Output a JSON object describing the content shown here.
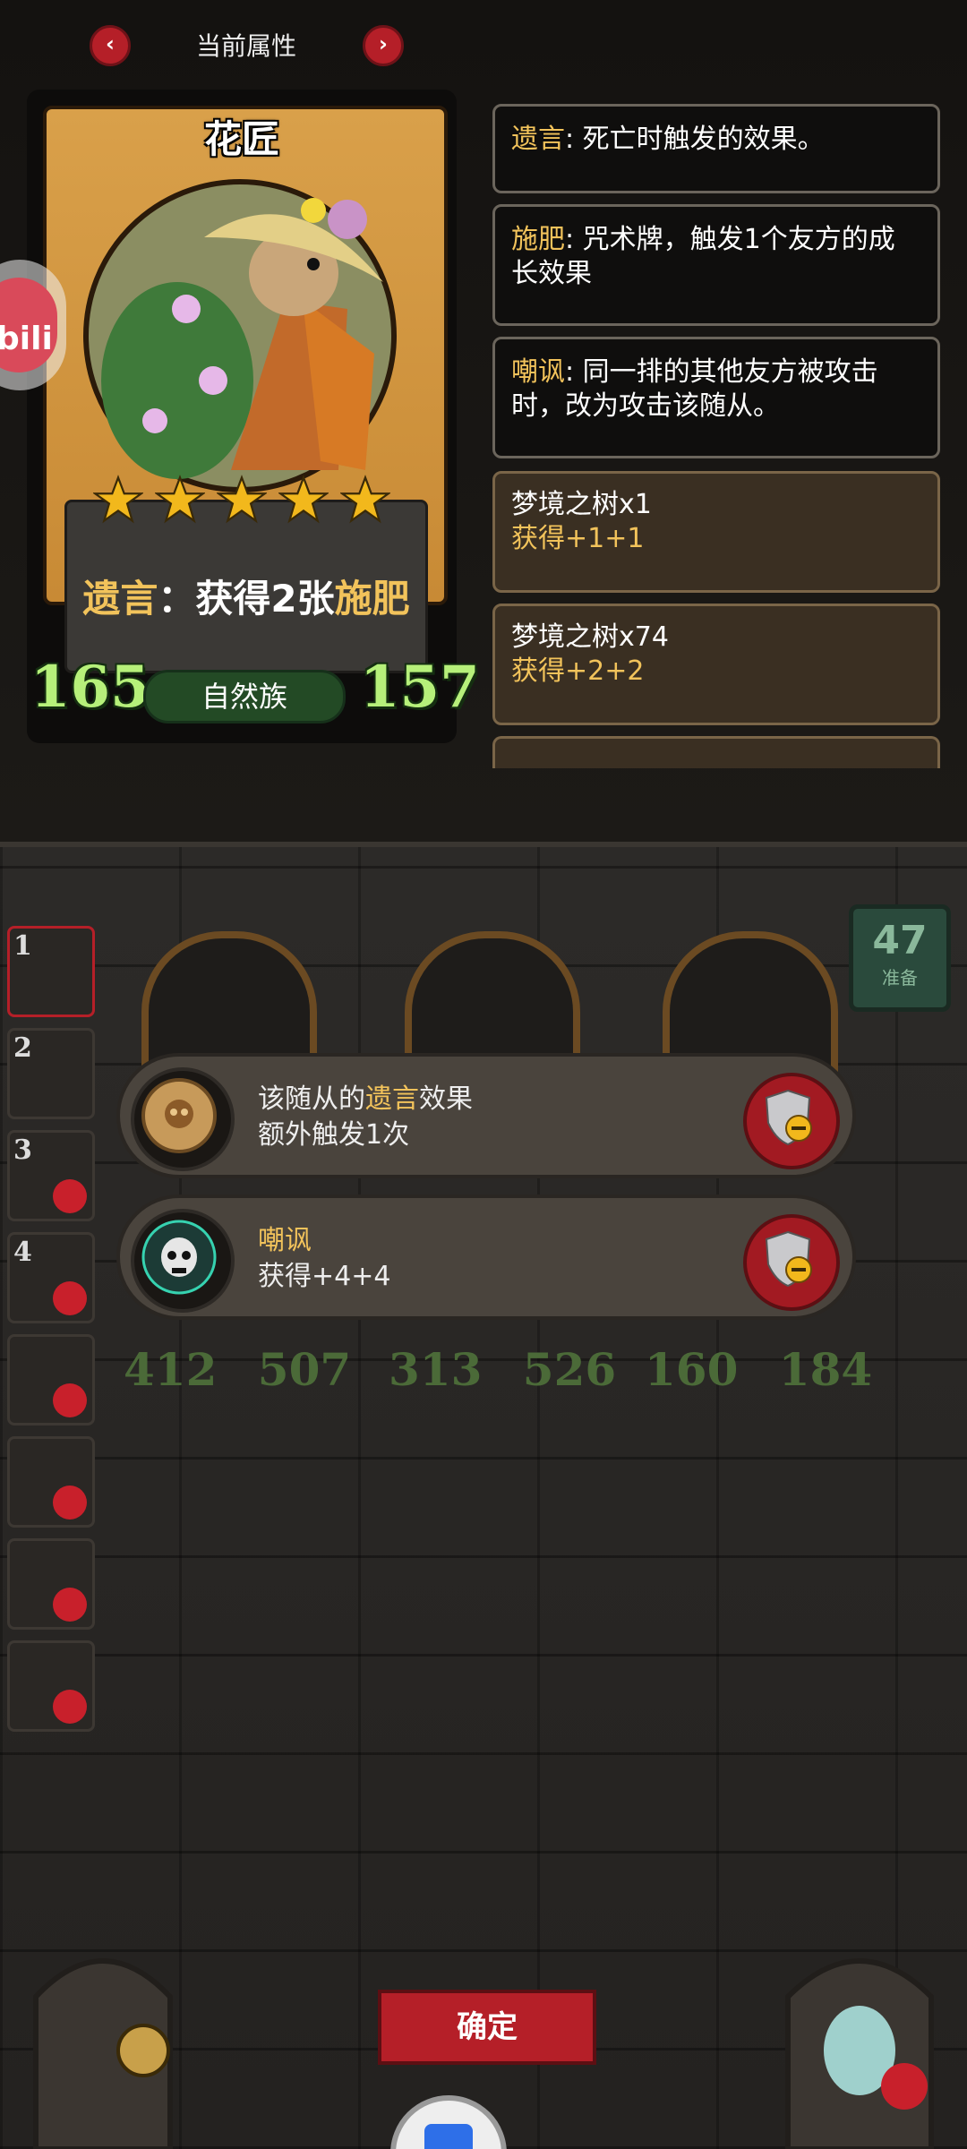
{
  "header": {
    "title": "当前属性",
    "prev_icon": "chevron-left-icon",
    "next_icon": "chevron-right-icon"
  },
  "card": {
    "name": "花匠",
    "stars": 5,
    "text_prefix": "遗言",
    "text_sep": "：",
    "text_body": "获得2张",
    "text_kw": "施肥",
    "tribe": "自然族",
    "attack": "165",
    "health": "157"
  },
  "keywords": [
    {
      "name": "遗言",
      "desc": ": 死亡时触发的效果。"
    },
    {
      "name": "施肥",
      "desc": ": 咒术牌，触发1个友方的成长效果"
    },
    {
      "name": "嘲讽",
      "desc": ": 同一排的其他友方被攻击时，改为攻击该随从。"
    }
  ],
  "buffs": [
    {
      "source": "梦境之树x1",
      "gain": "获得+1+1"
    },
    {
      "source": "梦境之树x74",
      "gain": "获得+2+2"
    }
  ],
  "board": {
    "counter_value": "47",
    "counter_label": "准备",
    "minion_stats": [
      {
        "atk": "412",
        "hp": "507"
      },
      {
        "atk": "313",
        "hp": "526"
      },
      {
        "atk": "160",
        "hp": "184"
      }
    ],
    "sidebar_numbers": [
      "1",
      "2",
      "3",
      "4"
    ]
  },
  "effects": [
    {
      "pre": "该随从的",
      "kw": "遗言",
      "post": "效果",
      "line2": "额外触发1次"
    },
    {
      "kw": "嘲讽",
      "line2": "获得+4+4"
    }
  ],
  "confirm_label": "确定",
  "overlay": {
    "bili_label": "bili"
  },
  "colors": {
    "keyword": "#f2c35b",
    "button_red": "#b51f28",
    "stat_green": "#b6f07a"
  }
}
